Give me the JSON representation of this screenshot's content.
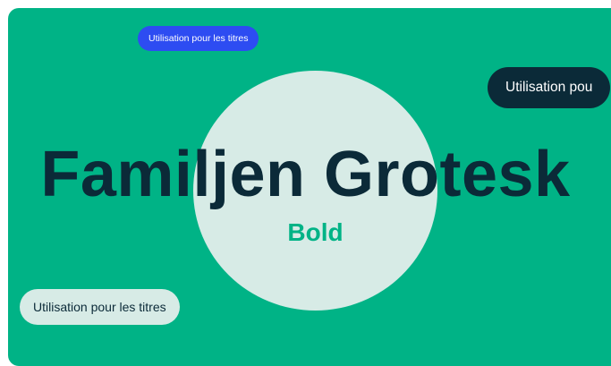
{
  "colors": {
    "background": "#00b386",
    "circle": "#d7ebe6",
    "title": "#0b2a38",
    "subtitle": "#00b386",
    "pill_blue_bg": "#2d4cf2",
    "pill_blue_text": "#ffffff",
    "pill_dark_bg": "#0b2a38",
    "pill_dark_text": "#ffffff",
    "pill_light_bg": "#d7ebe6",
    "pill_light_text": "#0b2a38"
  },
  "specimen": {
    "title": "Familjen Grotesk",
    "weight": "Bold"
  },
  "tags": {
    "top": "Utilisation pour les titres",
    "right": "Utilisation pou",
    "bottom": "Utilisation pour les titres"
  }
}
